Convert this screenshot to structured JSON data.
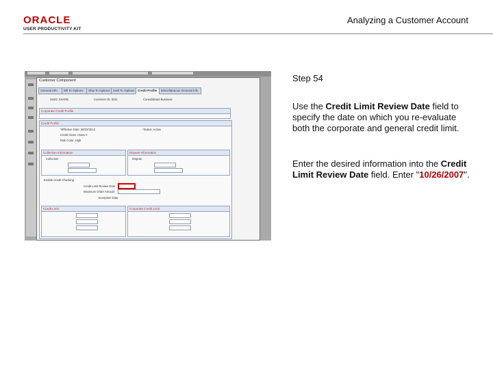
{
  "logo": {
    "brand": "ORACLE",
    "product": "USER PRODUCTIVITY KIT"
  },
  "header": {
    "title": "Analyzing a Customer Account"
  },
  "step": {
    "label": "Step 54"
  },
  "instruction": {
    "pre": "Use the ",
    "field": "Credit Limit Review Date",
    "post": " field to specify the date on which you re-evaluate both the corporate and general credit limit."
  },
  "action": {
    "pre": "Enter the desired information into the ",
    "field": "Credit Limit Review Date",
    "mid": " field. Enter \"",
    "value": "10/26/2007",
    "post": "\"."
  },
  "screenshot": {
    "window_title": "Customer Component",
    "tabs": [
      "General Info",
      "Bill To Options",
      "Ship To Options",
      "Sold To Options",
      "Credit Profile",
      "Miscellaneous General Info"
    ],
    "active_tab": "Credit Profile",
    "setid_label": "SetID: SHARE",
    "customer_label": "Customer ID: 0011",
    "business_label": "Consolidated Business",
    "corporate_box": "Corporate Credit Profile",
    "credit_box": "Credit Profile",
    "effective_date_label": "*Effective Date: 08/22/2013",
    "status_label": "*Status: Active",
    "credit_class_label": "Credit Class: Class A",
    "risk_code_label": "Risk Code: High",
    "collection_box": "Collection Information",
    "dispute_box": "Dispute Information",
    "collection_check": "Collection",
    "dispute_check": "Dispute",
    "enable_credit": "Enable Credit Checking",
    "credit_limit_review_label": "Credit Limit Review Date",
    "max_order_label": "Maximum Order Amount",
    "exception_label": "Exception Date",
    "credit_limit_box": "Credit Limit",
    "corporate_limit_box": "Corporate Credit Limit"
  }
}
